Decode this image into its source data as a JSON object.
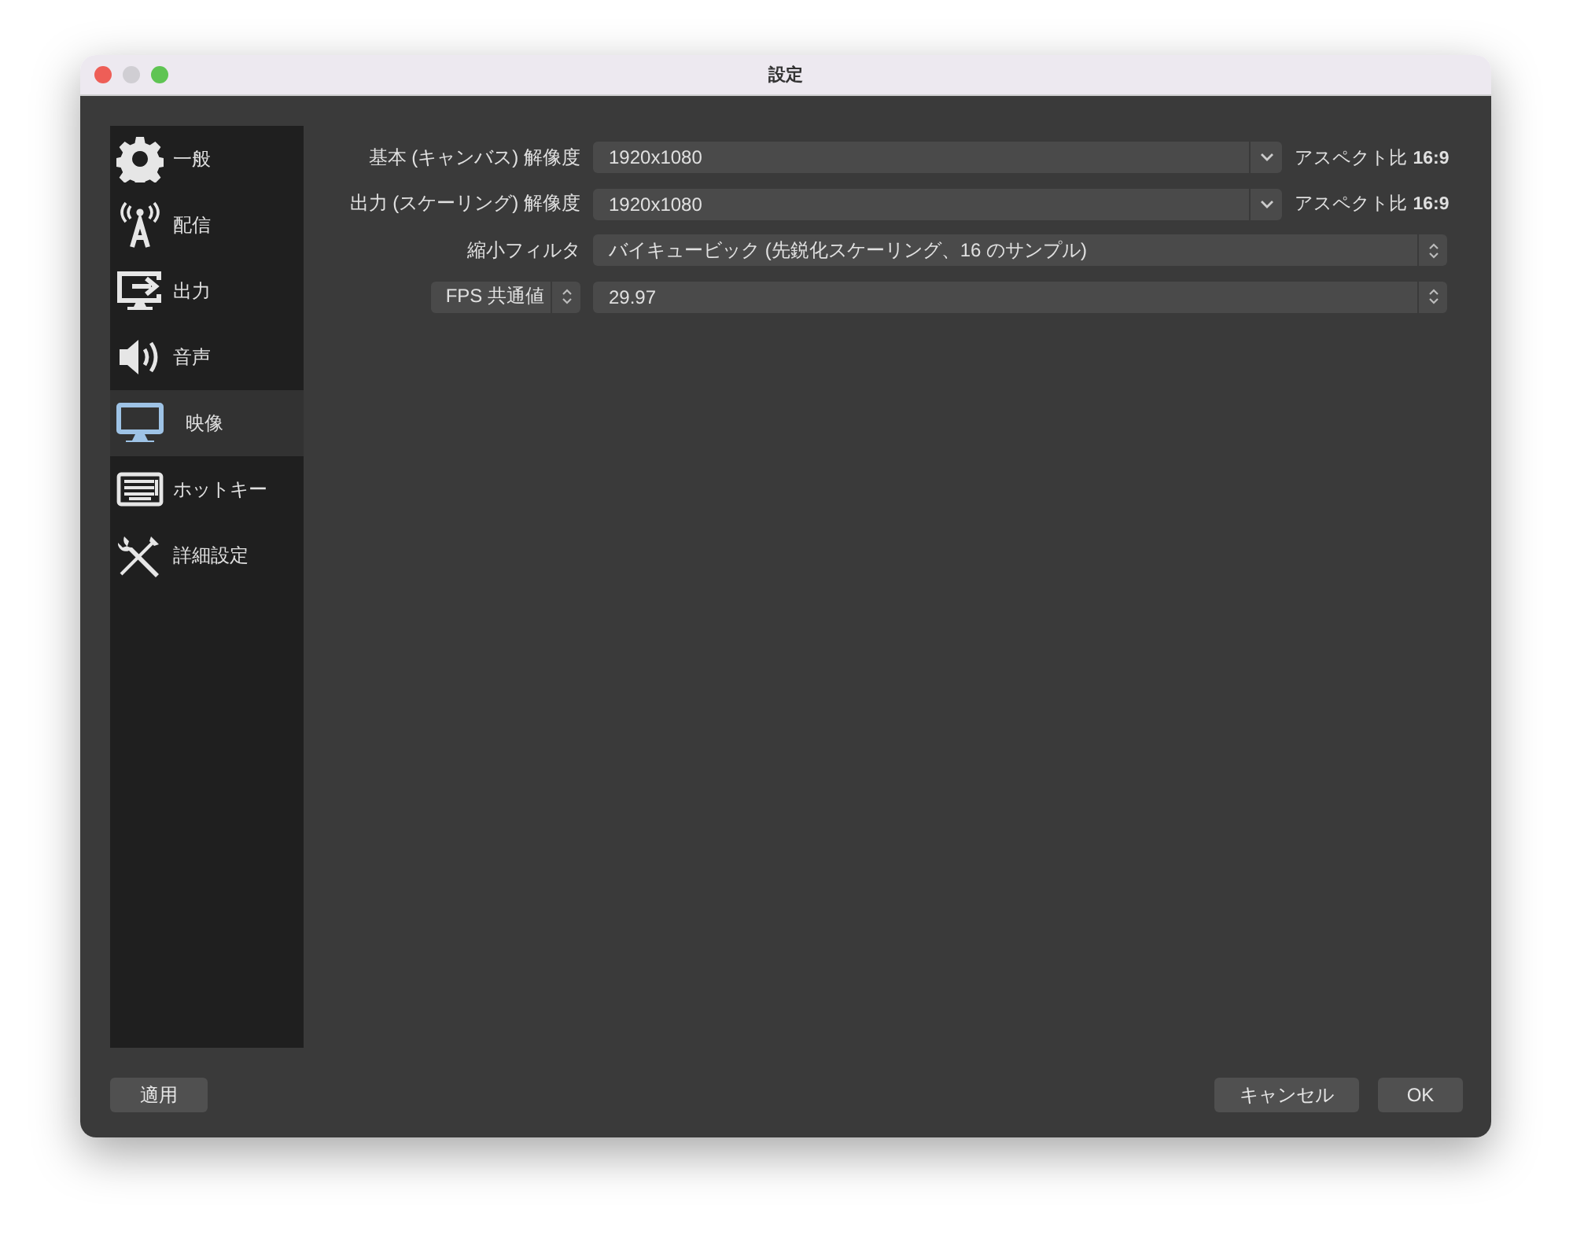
{
  "window": {
    "title": "設定"
  },
  "sidebar": {
    "items": [
      {
        "label": "一般",
        "selected": false
      },
      {
        "label": "配信",
        "selected": false
      },
      {
        "label": "出力",
        "selected": false
      },
      {
        "label": "音声",
        "selected": false
      },
      {
        "label": "映像",
        "selected": true
      },
      {
        "label": "ホットキー",
        "selected": false
      },
      {
        "label": "詳細設定",
        "selected": false
      }
    ]
  },
  "rows": [
    {
      "kind": "combo",
      "label": "基本 (キャンバス) 解像度",
      "value": "1920x1080",
      "aspect": "アスペクト比 **16:9**"
    },
    {
      "kind": "combo",
      "label": "出力 (スケーリング) 解像度",
      "value": "1920x1080",
      "aspect": "アスペクト比 **16:9**"
    },
    {
      "kind": "select",
      "label": "縮小フィルタ",
      "value": "バイキュービック (先鋭化スケーリング、16 のサンプル)"
    },
    {
      "kind": "select-label",
      "label": "FPS 共通値",
      "value": "29.97"
    }
  ],
  "buttons": {
    "apply": "適用",
    "cancel": "キャンセル",
    "ok": "OK"
  }
}
